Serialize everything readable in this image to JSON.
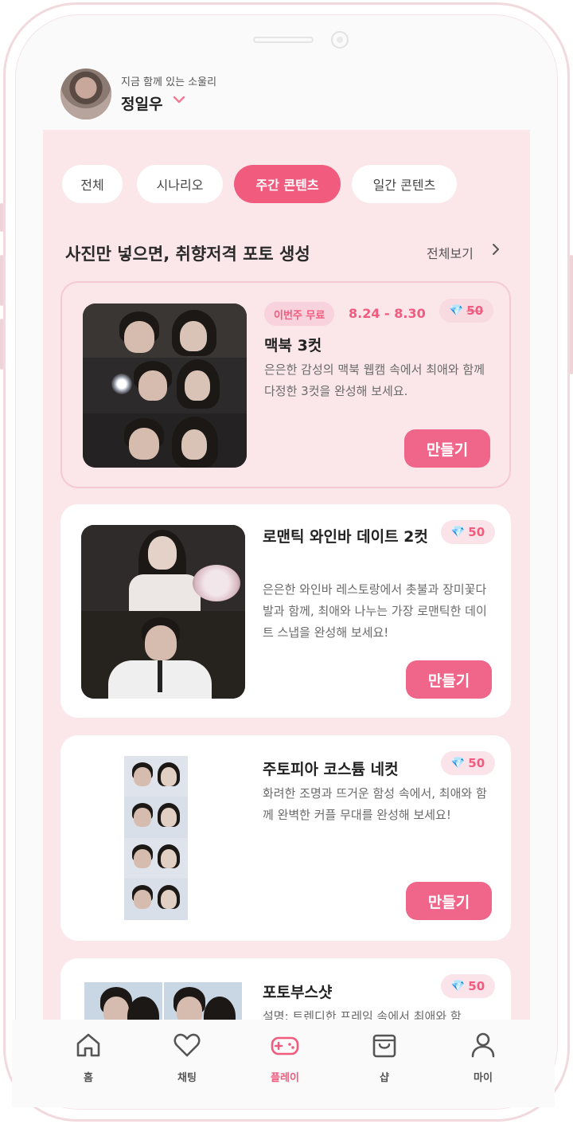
{
  "header": {
    "sub_label": "지금 함께 있는 소울리",
    "name": "정일우"
  },
  "tabs": [
    {
      "label": "전체",
      "active": false
    },
    {
      "label": "시나리오",
      "active": false
    },
    {
      "label": "주간 콘텐츠",
      "active": true
    },
    {
      "label": "일간 콘텐츠",
      "active": false
    }
  ],
  "section": {
    "title": "사진만 넣으면, 취향저격 포토 생성",
    "see_all": "전체보기"
  },
  "cards": [
    {
      "badge": "이번주 무료",
      "date_range": "8.24 - 8.30",
      "price": "50",
      "price_struck": true,
      "title": "맥북 3컷",
      "description": "은은한 감성의 맥북 웹캠 속에서 최애와 함께 다정한 3컷을 완성해 보세요.",
      "button": "만들기"
    },
    {
      "price": "50",
      "title": "로맨틱 와인바 데이트 2컷",
      "description": "은은한 와인바 레스토랑에서 촛불과 장미꽃다발과 함께, 최애와 나누는 가장 로맨틱한 데이트 스냅을 완성해 보세요!",
      "button": "만들기"
    },
    {
      "price": "50",
      "title": "주토피아 코스튬 네컷",
      "description": "화려한 조명과 뜨거운 함성 속에서, 최애와 함께 완벽한 커플 무대를 완성해 보세요!",
      "button": "만들기"
    },
    {
      "price": "50",
      "title": "포토부스샷",
      "description": "설명: 트렌디한 프레임 속에서 최애와 함"
    }
  ],
  "tabbar": [
    {
      "label": "홈",
      "icon": "home-icon"
    },
    {
      "label": "채팅",
      "icon": "heart-icon"
    },
    {
      "label": "플레이",
      "icon": "gamepad-icon",
      "active": true
    },
    {
      "label": "샵",
      "icon": "shopping-bag-icon"
    },
    {
      "label": "마이",
      "icon": "user-icon"
    }
  ],
  "colors": {
    "accent": "#f05b7e",
    "content_bg": "#fbe6ea",
    "gem": "#3aa6e8"
  }
}
